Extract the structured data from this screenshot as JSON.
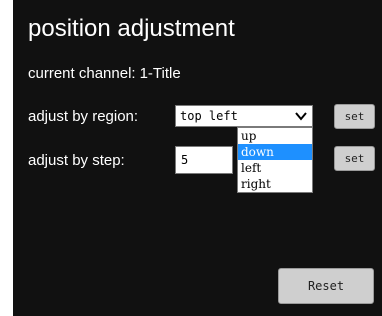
{
  "dialog": {
    "title": "position adjustment",
    "channel_label": "current channel:",
    "channel_value": "1-Title",
    "region_label": "adjust by region:",
    "step_label": "adjust by step:"
  },
  "region_select": {
    "selected": "top left",
    "options": [
      "up",
      "down",
      "left",
      "right"
    ],
    "highlighted": "down"
  },
  "step_input": {
    "value": "5"
  },
  "buttons": {
    "set_region": "set",
    "set_step": "set",
    "reset": "Reset"
  },
  "colors": {
    "panel_background": "#111111",
    "highlight": "#1e90ff",
    "button": "#cfcfcf"
  }
}
